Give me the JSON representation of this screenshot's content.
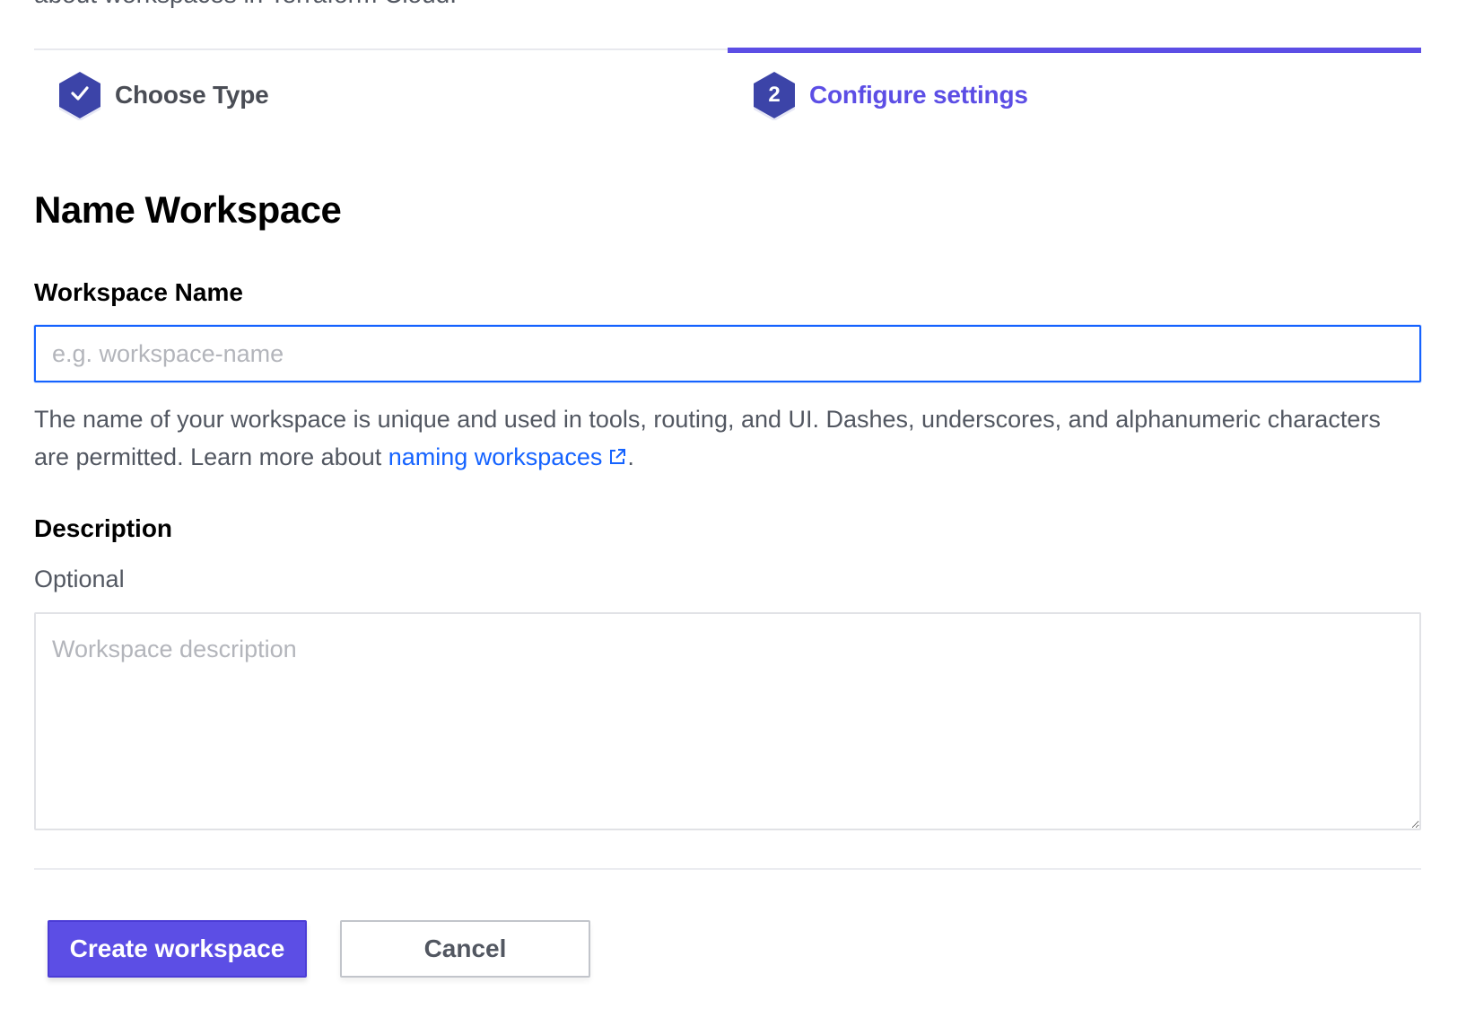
{
  "intro": {
    "text": "about workspaces in Terraform Cloud."
  },
  "steps": [
    {
      "label": "Choose Type",
      "marker": "check-icon",
      "state": "completed"
    },
    {
      "label": "Configure settings",
      "marker": "2",
      "state": "active"
    }
  ],
  "colors": {
    "accent": "#5c4ee5",
    "completed_step": "#3c44a8",
    "link": "#1563ff",
    "focus_border": "#1563ff"
  },
  "main": {
    "heading": "Name Workspace",
    "workspace_name": {
      "label": "Workspace Name",
      "value": "",
      "placeholder": "e.g. workspace-name",
      "help_prefix": "The name of your workspace is unique and used in tools, routing, and UI. Dashes, underscores, and alphanumeric characters are permitted. Learn more about ",
      "help_link": "naming workspaces",
      "help_suffix": "."
    },
    "description": {
      "label": "Description",
      "optional": "Optional",
      "value": "",
      "placeholder": "Workspace description"
    }
  },
  "actions": {
    "create_label": "Create workspace",
    "cancel_label": "Cancel"
  }
}
